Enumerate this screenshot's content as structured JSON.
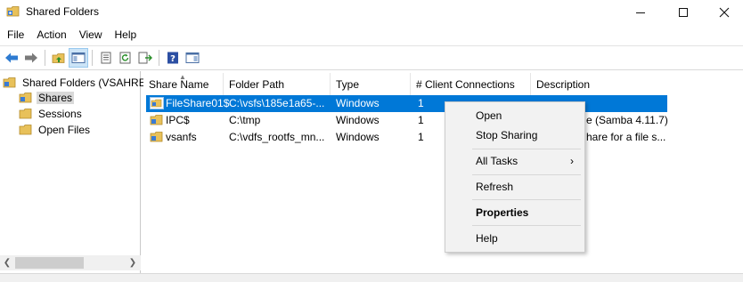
{
  "window": {
    "title": "Shared Folders",
    "icon": "shared-folder-icon"
  },
  "menu": {
    "items": [
      "File",
      "Action",
      "View",
      "Help"
    ]
  },
  "toolbar": {
    "buttons": [
      "back-arrow-icon",
      "forward-arrow-icon",
      "up-folder-icon",
      "show-hide-tree-icon",
      "properties-icon",
      "refresh-icon",
      "export-list-icon",
      "help-icon",
      "show-action-pane-icon"
    ]
  },
  "tree": {
    "root": "Shared Folders (VSAHREC",
    "items": [
      "Shares",
      "Sessions",
      "Open Files"
    ],
    "selected": "Shares"
  },
  "list": {
    "columns": [
      "Share Name",
      "Folder Path",
      "Type",
      "# Client Connections",
      "Description"
    ],
    "rows": [
      {
        "name": "FileShare01$",
        "path": "C:\\vsfs\\185e1a65-...",
        "type": "Windows",
        "connections": "1",
        "description": ""
      },
      {
        "name": "IPC$",
        "path": "C:\\tmp",
        "type": "Windows",
        "connections": "1",
        "description": "e (Samba 4.11.7)"
      },
      {
        "name": "vsanfs",
        "path": "C:\\vdfs_rootfs_mn...",
        "type": "Windows",
        "connections": "1",
        "description": "hare for a file s..."
      }
    ],
    "selected_row": 0
  },
  "context_menu": {
    "items": [
      "Open",
      "Stop Sharing",
      "All Tasks",
      "Refresh",
      "Properties",
      "Help"
    ],
    "submenu_arrow": "›"
  },
  "colors": {
    "selection": "#0078d7",
    "menu_bg": "#f2f2f2",
    "folder_yellow": "#e8c15a"
  }
}
